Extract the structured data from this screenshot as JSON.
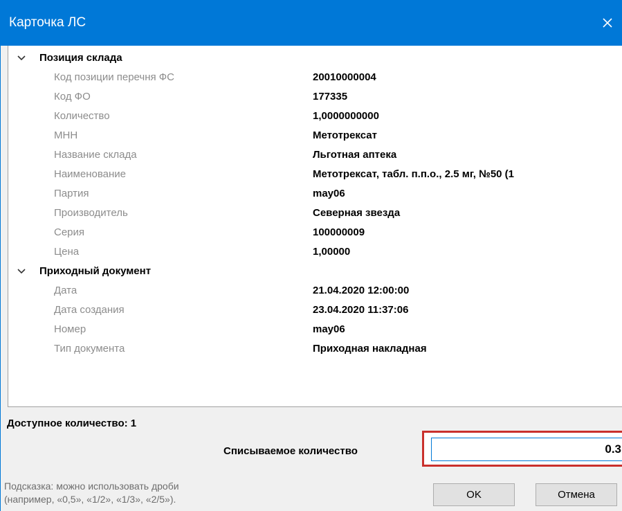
{
  "window": {
    "title": "Карточка ЛС"
  },
  "grid": {
    "categories": [
      {
        "label": "Позиция склада",
        "properties": [
          {
            "name": "Код позиции перечня ФС",
            "value": "20010000004"
          },
          {
            "name": "Код ФО",
            "value": "177335"
          },
          {
            "name": "Количество",
            "value": "1,0000000000"
          },
          {
            "name": "МНН",
            "value": "Метотрексат"
          },
          {
            "name": "Название склада",
            "value": "Льготная аптека"
          },
          {
            "name": "Наименование",
            "value": "Метотрексат, табл. п.п.о., 2.5 мг, №50 (1"
          },
          {
            "name": "Партия",
            "value": "may06"
          },
          {
            "name": "Производитель",
            "value": "Северная звезда"
          },
          {
            "name": "Серия",
            "value": "100000009"
          },
          {
            "name": "Цена",
            "value": "1,00000"
          }
        ]
      },
      {
        "label": "Приходный документ",
        "properties": [
          {
            "name": "Дата",
            "value": "21.04.2020 12:00:00"
          },
          {
            "name": "Дата создания",
            "value": "23.04.2020 11:37:06"
          },
          {
            "name": "Номер",
            "value": "may06"
          },
          {
            "name": "Тип документа",
            "value": "Приходная накладная"
          }
        ]
      }
    ]
  },
  "footer": {
    "available": "Доступное количество: 1",
    "writeoff_label": "Списываемое количество",
    "writeoff_value": "0.3",
    "hint_line1": "Подсказка: можно использовать дроби",
    "hint_line2": "(например, «0,5», «1/2», «1/3», «2/5»).",
    "ok_label": "OK",
    "cancel_label": "Отмена"
  },
  "colors": {
    "titlebar": "#0078d7",
    "highlight_border": "#c9302c",
    "property_name": "#8c8c8c"
  },
  "icons": {
    "close": "close-icon",
    "expander": "chevron-down-icon"
  }
}
